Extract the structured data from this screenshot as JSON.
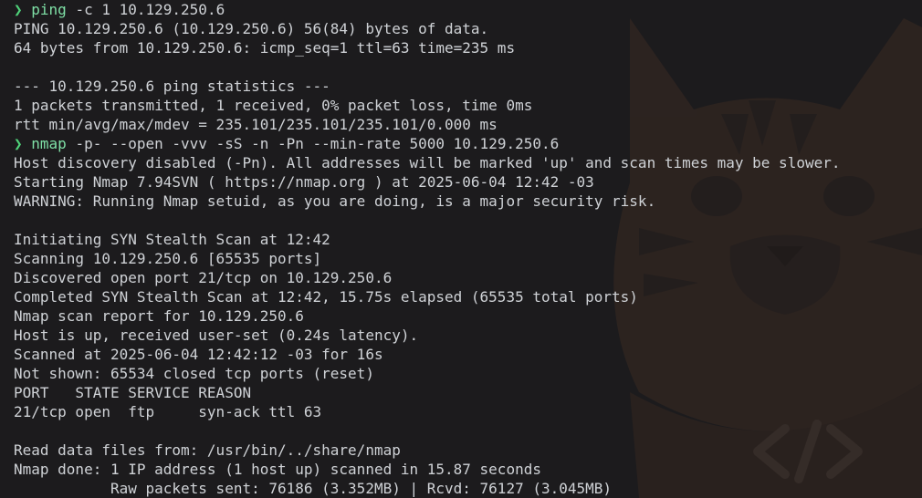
{
  "colors": {
    "background": "#1c1b1d",
    "text": "#cfd2d6",
    "prompt": "#4fd37a",
    "command": "#7fe0a6",
    "wallpaper_accent": "#3a2a22"
  },
  "icons": {
    "prompt": "chevron-right-icon",
    "wallpaper": "cat-mascot-icon",
    "code": "code-brackets-icon"
  },
  "lines": [
    {
      "kind": "cmd",
      "prompt": "❯",
      "command": "ping",
      "args": " -c 1 10.129.250.6"
    },
    {
      "kind": "out",
      "text": "PING 10.129.250.6 (10.129.250.6) 56(84) bytes of data."
    },
    {
      "kind": "out",
      "text": "64 bytes from 10.129.250.6: icmp_seq=1 ttl=63 time=235 ms"
    },
    {
      "kind": "out",
      "text": ""
    },
    {
      "kind": "out",
      "text": "--- 10.129.250.6 ping statistics ---"
    },
    {
      "kind": "out",
      "text": "1 packets transmitted, 1 received, 0% packet loss, time 0ms"
    },
    {
      "kind": "out",
      "text": "rtt min/avg/max/mdev = 235.101/235.101/235.101/0.000 ms"
    },
    {
      "kind": "cmd",
      "prompt": "❯",
      "command": "nmap",
      "args": " -p- --open -vvv -sS -n -Pn --min-rate 5000 10.129.250.6"
    },
    {
      "kind": "out",
      "text": "Host discovery disabled (-Pn). All addresses will be marked 'up' and scan times may be slower."
    },
    {
      "kind": "out",
      "text": "Starting Nmap 7.94SVN ( https://nmap.org ) at 2025-06-04 12:42 -03"
    },
    {
      "kind": "out",
      "text": "WARNING: Running Nmap setuid, as you are doing, is a major security risk."
    },
    {
      "kind": "out",
      "text": ""
    },
    {
      "kind": "out",
      "text": "Initiating SYN Stealth Scan at 12:42"
    },
    {
      "kind": "out",
      "text": "Scanning 10.129.250.6 [65535 ports]"
    },
    {
      "kind": "out",
      "text": "Discovered open port 21/tcp on 10.129.250.6"
    },
    {
      "kind": "out",
      "text": "Completed SYN Stealth Scan at 12:42, 15.75s elapsed (65535 total ports)"
    },
    {
      "kind": "out",
      "text": "Nmap scan report for 10.129.250.6"
    },
    {
      "kind": "out",
      "text": "Host is up, received user-set (0.24s latency)."
    },
    {
      "kind": "out",
      "text": "Scanned at 2025-06-04 12:42:12 -03 for 16s"
    },
    {
      "kind": "out",
      "text": "Not shown: 65534 closed tcp ports (reset)"
    },
    {
      "kind": "out",
      "text": "PORT   STATE SERVICE REASON"
    },
    {
      "kind": "out",
      "text": "21/tcp open  ftp     syn-ack ttl 63"
    },
    {
      "kind": "out",
      "text": ""
    },
    {
      "kind": "out",
      "text": "Read data files from: /usr/bin/../share/nmap"
    },
    {
      "kind": "out",
      "text": "Nmap done: 1 IP address (1 host up) scanned in 15.87 seconds"
    },
    {
      "kind": "out",
      "text": "           Raw packets sent: 76186 (3.352MB) | Rcvd: 76127 (3.045MB)"
    }
  ]
}
